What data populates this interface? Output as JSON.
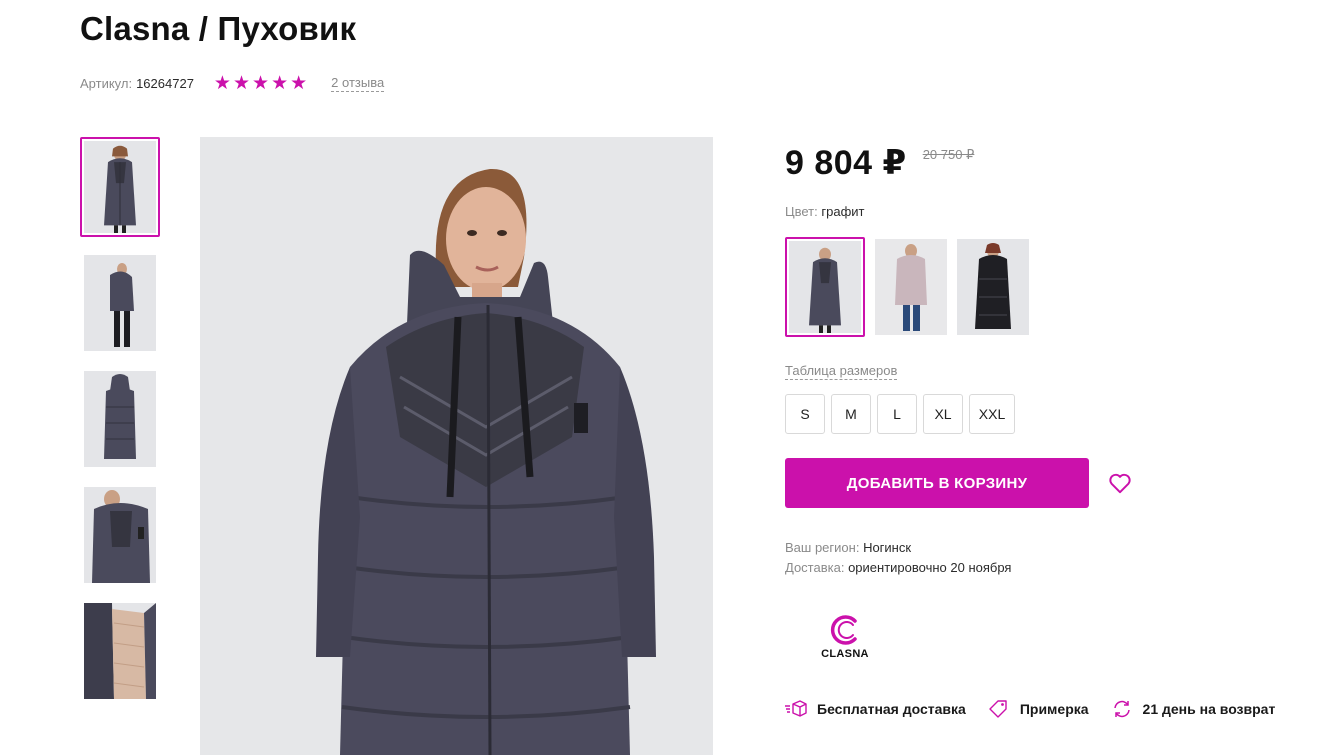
{
  "product": {
    "title": "Clasna / Пуховик",
    "sku_label": "Артикул:",
    "sku_value": "16264727",
    "rating_stars": 5,
    "reviews_link": "2 отзыва"
  },
  "pricing": {
    "price": "9 804 ₽",
    "old_price": "20 750 ₽"
  },
  "color": {
    "label": "Цвет:",
    "value": "графит",
    "options": [
      "графит",
      "розовый",
      "черный"
    ]
  },
  "sizes": {
    "table_link": "Таблица размеров",
    "options": [
      "S",
      "M",
      "L",
      "XL",
      "XXL"
    ]
  },
  "actions": {
    "add_to_cart": "ДОБАВИТЬ В КОРЗИНУ",
    "favorite_icon": "heart-icon"
  },
  "delivery": {
    "region_label": "Ваш регион:",
    "region_value": "Ногинск",
    "delivery_label": "Доставка:",
    "delivery_value": "ориентировочно 20 ноября"
  },
  "brand": {
    "name": "CLASNA"
  },
  "perks": [
    {
      "label": "Бесплатная доставка",
      "icon": "box-icon"
    },
    {
      "label": "Примерка",
      "icon": "tag-icon"
    },
    {
      "label": "21 день на возврат",
      "icon": "refresh-icon"
    }
  ],
  "colors": {
    "accent": "#cb11ab",
    "price_text": "#111111",
    "muted_text": "#8a8a8a"
  }
}
